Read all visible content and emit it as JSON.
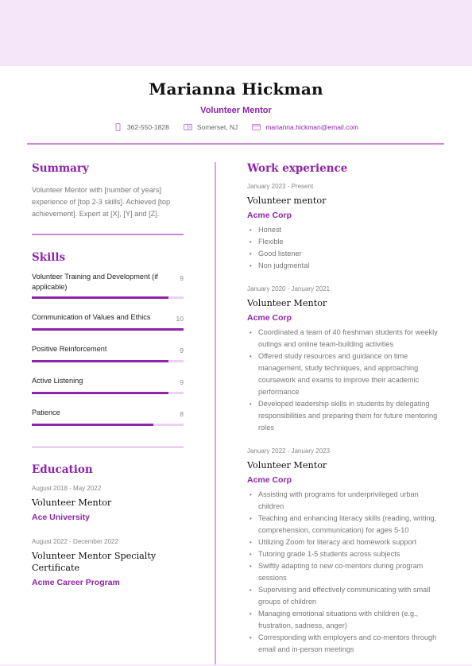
{
  "header": {
    "name": "Marianna Hickman",
    "role": "Volunteer Mentor",
    "contacts": {
      "phone": {
        "icon": "phone-icon",
        "text": "362-550-1828"
      },
      "location": {
        "icon": "location-card-icon",
        "text": "Somerset, NJ"
      },
      "email": {
        "icon": "envelope-icon",
        "text": "marianna.hickman@email.com"
      }
    }
  },
  "colors": {
    "accent": "#8e24aa",
    "band": "#f6e6fa",
    "rule": "#c98bd8",
    "bar_track": "#ead2f1"
  },
  "summary": {
    "title": "Summary",
    "text": "Volunteer Mentor with [number of years] experience of [top 2-3 skills]. Achieved [top achievement]. Expert at [X], [Y] and [Z]."
  },
  "skills": {
    "title": "Skills",
    "scale_max": 10,
    "items": [
      {
        "name": "Volunteer Training and Development (if applicable)",
        "value": 9
      },
      {
        "name": "Communication of Values and Ethics",
        "value": 10
      },
      {
        "name": "Positive Reinforcement",
        "value": 9
      },
      {
        "name": "Active Listening",
        "value": 9
      },
      {
        "name": "Patience",
        "value": 8
      }
    ]
  },
  "education": {
    "title": "Education",
    "items": [
      {
        "date": "August 2018 - May 2022",
        "title": "Volunteer Mentor",
        "org": "Ace University"
      },
      {
        "date": "August 2022 - December 2022",
        "title": "Volunteer Mentor Specialty Certificate",
        "org": "Acme Career Program"
      }
    ]
  },
  "work": {
    "title": "Work experience",
    "items": [
      {
        "date": "January 2023 - Present",
        "title": "Volunteer mentor",
        "org": "Acme Corp",
        "bullets": [
          "Honest",
          "Flexible",
          "Good listener",
          "Non judgmental"
        ]
      },
      {
        "date": "January 2020 - January 2021",
        "title": "Volunteer Mentor",
        "org": "Acme Corp",
        "bullets": [
          "Coordinated a team of 40 freshman students for weekly outings and online team-building activities",
          "Offered study resources and guidance on time management, study techniques, and approaching coursework and exams to improve their academic performance",
          "Developed leadership skills in students by delegating responsibilities and preparing them for future mentoring roles"
        ]
      },
      {
        "date": "January 2022 - January 2023",
        "title": "Volunteer Mentor",
        "org": "Acme Corp",
        "bullets": [
          "Assisting with programs for underprivileged urban children",
          "Teaching and enhancing literacy skills (reading, writing, comprehension, communication) for ages 5-10",
          "Utilizing Zoom for literacy and homework support",
          "Tutoring grade 1-5 students across subjects",
          "Swiftly adapting to new co-mentors during program sessions",
          "Supervising and effectively communicating with small groups of children",
          "Managing emotional situations with children (e.g., frustration, sadness, anger)",
          "Corresponding with employers and co-mentors through email and in-person meetings"
        ]
      }
    ]
  }
}
